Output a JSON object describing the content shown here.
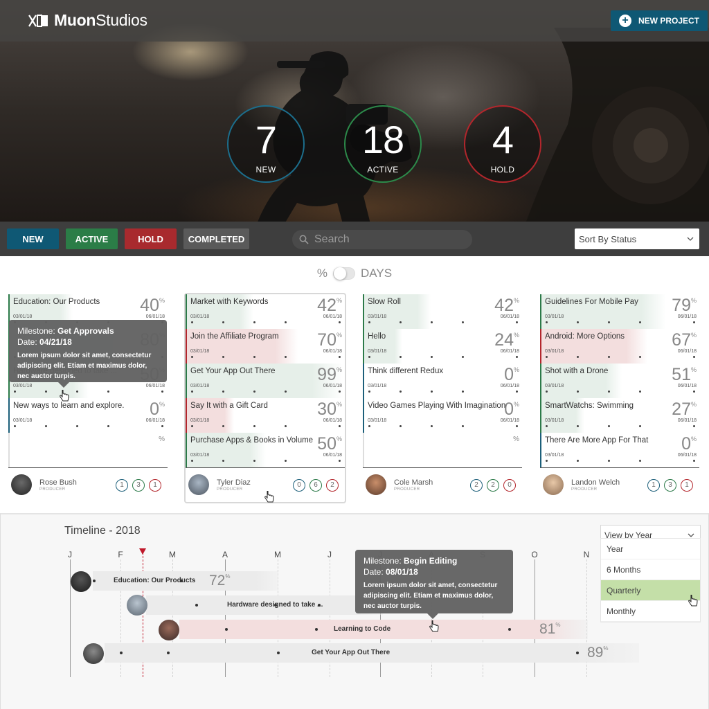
{
  "brand": {
    "name_bold": "Muon",
    "name_light": "Studios"
  },
  "header": {
    "new_project_label": "NEW PROJECT"
  },
  "stats": [
    {
      "value": "7",
      "label": "NEW",
      "color": "#1c6e8c"
    },
    {
      "value": "18",
      "label": "ACTIVE",
      "color": "#2c8a4a"
    },
    {
      "value": "4",
      "label": "HOLD",
      "color": "#b3262c"
    }
  ],
  "filters": [
    {
      "label": "NEW",
      "color": "#0f5874"
    },
    {
      "label": "ACTIVE",
      "color": "#2b7d47"
    },
    {
      "label": "HOLD",
      "color": "#a82a2e"
    },
    {
      "label": "COMPLETED",
      "color": "#5a5a5a"
    }
  ],
  "search": {
    "placeholder": "Search"
  },
  "sort": {
    "value": "Sort By Status"
  },
  "toggle": {
    "left": "%",
    "right": "DAYS"
  },
  "columns": [
    {
      "projects": [
        {
          "title": "Education: Our Products",
          "pct": "40",
          "start": "03/01/18",
          "end": "06/01/18",
          "status": "active",
          "progress": 0.4
        },
        {
          "title": "",
          "pct": "80",
          "start": "",
          "end": "",
          "status": "active",
          "progress": 0.8
        },
        {
          "title": "Hardware designed to take ...",
          "pct": "50",
          "start": "03/01/18",
          "end": "06/01/18",
          "status": "active",
          "progress": 0.5
        },
        {
          "title": "New ways to learn and explore.",
          "pct": "0",
          "start": "03/01/18",
          "end": "06/01/18",
          "status": "new",
          "progress": 0
        },
        {
          "title": "",
          "pct": "",
          "start": "",
          "end": "",
          "status": "empty",
          "progress": 0
        }
      ],
      "producer": {
        "name": "Rose Bush",
        "role": "PRODUCER",
        "counts": [
          "1",
          "3",
          "1"
        ]
      },
      "tooltip": {
        "milestone_label": "Milestone:",
        "milestone": "Get Approvals",
        "date_label": "Date:",
        "date": "04/21/18",
        "body": "Lorem ipsum dolor sit amet, consectetur adipiscing elit. Etiam et maximus dolor, nec auctor turpis."
      }
    },
    {
      "projects": [
        {
          "title": "Market with Keywords",
          "pct": "42",
          "start": "03/01/18",
          "end": "06/01/18",
          "status": "active",
          "progress": 0.42
        },
        {
          "title": "Join the Affiliate Program",
          "pct": "70",
          "start": "03/01/18",
          "end": "06/01/18",
          "status": "hold",
          "progress": 0.7
        },
        {
          "title": "Get Your App Out There",
          "pct": "99",
          "start": "03/01/18",
          "end": "06/01/18",
          "status": "active",
          "progress": 0.99
        },
        {
          "title": "Say It with a Gift Card",
          "pct": "30",
          "start": "03/01/18",
          "end": "06/01/18",
          "status": "hold",
          "progress": 0.3
        },
        {
          "title": "Purchase Apps & Books in Volume",
          "pct": "50",
          "start": "03/01/18",
          "end": "06/01/18",
          "status": "active",
          "progress": 0.5
        }
      ],
      "producer": {
        "name": "Tyler Diaz",
        "role": "PRODUCER",
        "counts": [
          "0",
          "6",
          "2"
        ]
      }
    },
    {
      "projects": [
        {
          "title": "Slow Roll",
          "pct": "42",
          "start": "03/01/18",
          "end": "06/01/18",
          "status": "active",
          "progress": 0.42
        },
        {
          "title": "Hello",
          "pct": "24",
          "start": "03/01/18",
          "end": "06/01/18",
          "status": "active",
          "progress": 0.24
        },
        {
          "title": "Think different Redux",
          "pct": "0",
          "start": "03/01/18",
          "end": "06/01/18",
          "status": "new",
          "progress": 0
        },
        {
          "title": "Video Games Playing With Imagination",
          "pct": "0",
          "start": "03/01/18",
          "end": "06/01/18",
          "status": "new",
          "progress": 0
        },
        {
          "title": "",
          "pct": "",
          "start": "",
          "end": "",
          "status": "empty",
          "progress": 0
        }
      ],
      "producer": {
        "name": "Cole Marsh",
        "role": "PRODUCER",
        "counts": [
          "2",
          "2",
          "0"
        ]
      }
    },
    {
      "projects": [
        {
          "title": "Guidelines For Mobile Pay",
          "pct": "79",
          "start": "03/01/18",
          "end": "06/01/18",
          "status": "active",
          "progress": 0.79
        },
        {
          "title": "Android: More Options",
          "pct": "67",
          "start": "03/01/18",
          "end": "06/01/18",
          "status": "hold",
          "progress": 0.67
        },
        {
          "title": "Shot with a Drone",
          "pct": "51",
          "start": "03/01/18",
          "end": "06/01/18",
          "status": "active",
          "progress": 0.51
        },
        {
          "title": "SmartWatchs: Swimming",
          "pct": "27",
          "start": "03/01/18",
          "end": "06/01/18",
          "status": "active",
          "progress": 0.27
        },
        {
          "title": "There Are More App For That",
          "pct": "0",
          "start": "03/01/18",
          "end": "06/01/18",
          "status": "new",
          "progress": 0
        }
      ],
      "producer": {
        "name": "Landon Welch",
        "role": "PRODUCER",
        "counts": [
          "1",
          "3",
          "1"
        ]
      }
    }
  ],
  "timeline": {
    "title": "Timeline - 2018",
    "months": [
      "J",
      "F",
      "M",
      "A",
      "M",
      "J",
      "J",
      "A",
      "S",
      "O",
      "N"
    ],
    "bars": [
      {
        "label": "Education: Our Products",
        "pct": "72",
        "status": "active"
      },
      {
        "label": "Hardware designed to take ...",
        "pct": "",
        "status": "active"
      },
      {
        "label": "Learning to Code",
        "pct": "81",
        "status": "hold"
      },
      {
        "label": "Get Your App Out There",
        "pct": "89",
        "status": "active"
      }
    ],
    "view_select": {
      "value": "View by Year",
      "options": [
        "Year",
        "6 Months",
        "Quarterly",
        "Monthly"
      ],
      "highlighted": "Quarterly"
    },
    "tooltip": {
      "milestone_label": "Milestone:",
      "milestone": "Begin Editing",
      "date_label": "Date:",
      "date": "08/01/18",
      "body": "Lorem ipsum dolor sit amet, consectetur adipiscing elit. Etiam et maximus dolor, nec auctor turpis."
    }
  },
  "colors": {
    "new": "#1c5f7a",
    "active": "#2c7a49",
    "hold": "#b3262c",
    "active_fill": "#e6efe9",
    "hold_fill": "#f3dede"
  }
}
